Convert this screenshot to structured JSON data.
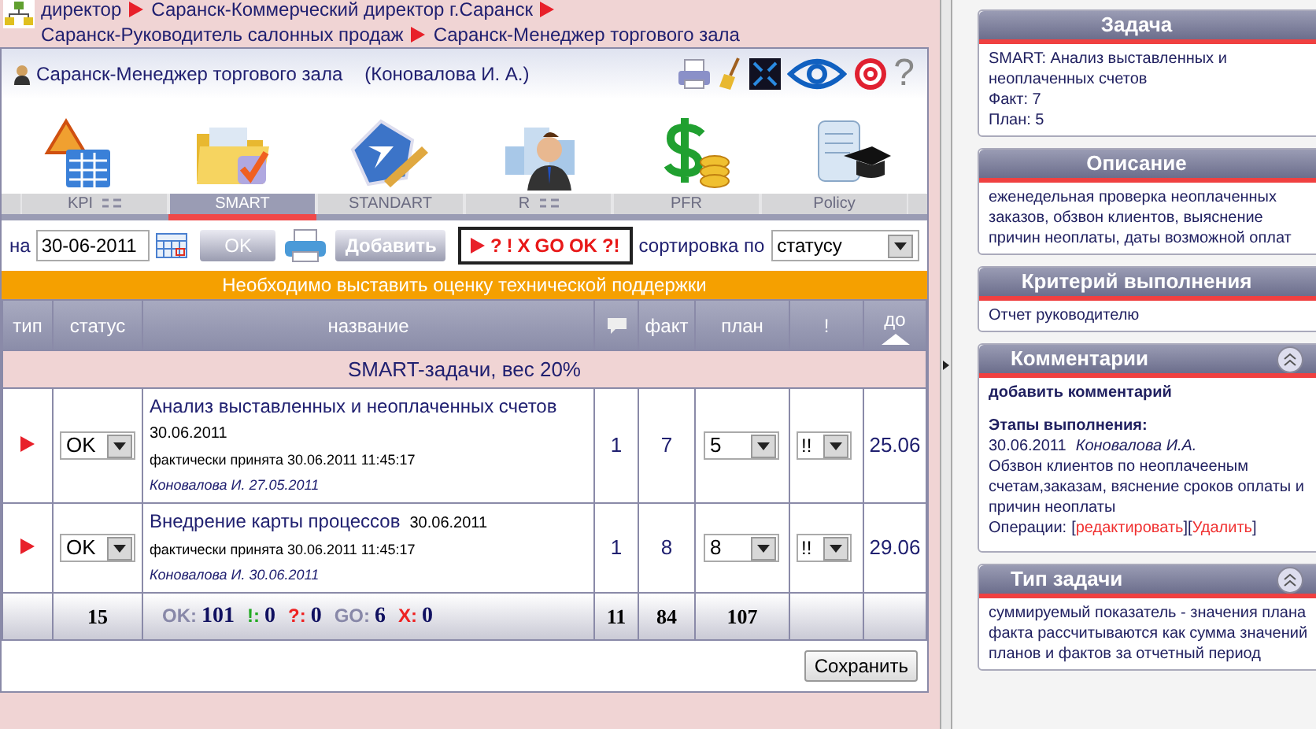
{
  "breadcrumb": [
    {
      "text": "директор"
    },
    {
      "text": "Саранск-Коммерческий директор г.Саранск"
    },
    {
      "text": "Саранск-Руководитель салонных продаж"
    },
    {
      "text": "Саранск-Менеджер торгового зала"
    }
  ],
  "header": {
    "position": "Саранск-Менеджер торгового зала",
    "person": "(Коновалова И. А.)",
    "help": "?"
  },
  "tabs": [
    {
      "label": "KPI",
      "kind": "kpi",
      "menu": true,
      "selected": false
    },
    {
      "label": "SMART",
      "kind": "smart",
      "menu": false,
      "selected": true
    },
    {
      "label": "STANDART",
      "kind": "goal",
      "menu": false,
      "selected": false
    },
    {
      "label": "R",
      "kind": "rating",
      "menu": true,
      "selected": false
    },
    {
      "label": "PFR",
      "kind": "money",
      "menu": false,
      "selected": false
    },
    {
      "label": "Policy",
      "kind": "policy",
      "menu": false,
      "selected": false
    }
  ],
  "toolbar": {
    "date_label": "на",
    "date": "30-06-2011",
    "ok": "OK",
    "add": "Добавить",
    "filter": [
      "?",
      "!",
      "X",
      "GO",
      "OK",
      "?!"
    ],
    "sort_label": "сортировка по",
    "sort": "статусу"
  },
  "banner": "Необходимо выставить оценку технической поддержки",
  "columns": [
    {
      "label": "тип",
      "kind": "text"
    },
    {
      "label": "статус",
      "kind": "text"
    },
    {
      "label": "название",
      "kind": "text"
    },
    {
      "kind": "comment"
    },
    {
      "label": "факт",
      "kind": "text"
    },
    {
      "label": "план",
      "kind": "text"
    },
    {
      "label": "!",
      "kind": "text"
    },
    {
      "label": "до",
      "kind": "sort"
    }
  ],
  "group": "SMART-задачи, вес 20%",
  "rows": [
    {
      "status": "OK",
      "title": "Анализ выставленных и неоплаченных счетов",
      "date": "30.06.2011",
      "accepted": "фактически принята 30.06.2011 11:45:17",
      "author": "Коновалова И. 27.05.2011",
      "comments": "1",
      "fact": "7",
      "plan": "5",
      "priority": "!!",
      "due": "25.06"
    },
    {
      "status": "OK",
      "title": "Внедрение карты процессов",
      "date": "30.06.2011",
      "accepted": "фактически принята 30.06.2011 11:45:17",
      "author": "Коновалова И. 30.06.2011",
      "comments": "1",
      "fact": "8",
      "plan": "8",
      "priority": "!!",
      "due": "29.06"
    }
  ],
  "footer": {
    "count": "15",
    "stats": [
      {
        "label": "OK:",
        "value": "101",
        "color": "#8888a8"
      },
      {
        "label": "!:",
        "value": "0",
        "color": "#22aa22"
      },
      {
        "label": "?:",
        "value": "0",
        "color": "#ee2222"
      },
      {
        "label": "GO:",
        "value": "6",
        "color": "#8888a8"
      },
      {
        "label": "X:",
        "value": "0",
        "color": "#ee2222"
      }
    ],
    "comments": "11",
    "fact": "84",
    "plan": "107"
  },
  "save": "Сохранить",
  "panels": [
    {
      "title": "Задача",
      "kind": "text",
      "collapse": false,
      "lines": [
        "SMART: Анализ выставленных и",
        "неоплаченных счетов",
        "Факт: 7",
        "План: 5"
      ]
    },
    {
      "title": "Описание",
      "kind": "text",
      "collapse": false,
      "lines": [
        "еженедельная проверка неоплаченных",
        "заказов, обзвон клиентов, выяснение",
        "причин неоплаты, даты возможной оплат"
      ]
    },
    {
      "title": "Критерий выполнения",
      "kind": "text",
      "collapse": false,
      "lines": [
        "Отчет руководителю"
      ]
    },
    {
      "title": "Комментарии",
      "kind": "comments",
      "collapse": true,
      "add": "добавить комментарий",
      "stages_title": "Этапы выполнения:",
      "date": "30.06.2011",
      "author": "Коновалова И.А.",
      "text": "Обзвон клиентов по неоплачееным счетам,заказам, вяснение сроков оплаты и причин неоплаты",
      "ops_label": "Операции:",
      "ops": [
        {
          "kind": "bracket",
          "text": "["
        },
        {
          "kind": "link",
          "text": "редактировать"
        },
        {
          "kind": "bracket",
          "text": "]["
        },
        {
          "kind": "link",
          "text": "Удалить"
        },
        {
          "kind": "bracket",
          "text": "]"
        }
      ]
    },
    {
      "title": "Тип задачи",
      "kind": "text",
      "collapse": true,
      "lines": [
        "суммируемый показатель - значения плана",
        "факта рассчитываются как сумма значений",
        "планов и фактов за отчетный период"
      ]
    }
  ]
}
